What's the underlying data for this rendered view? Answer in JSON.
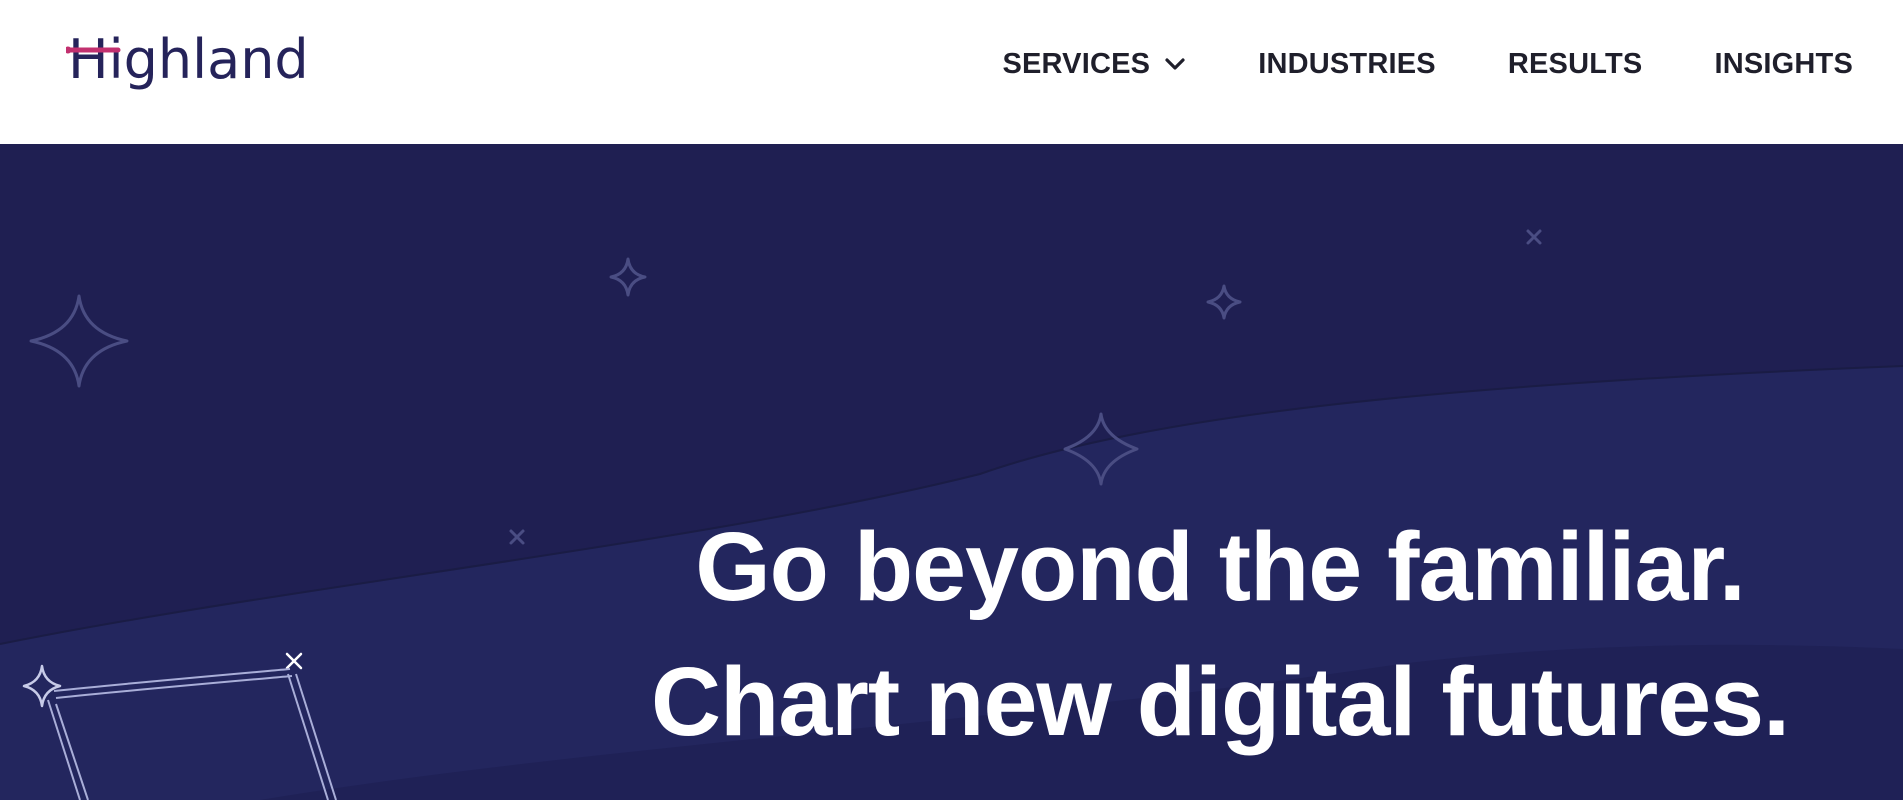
{
  "brand": {
    "name": "Highland",
    "logo_text": "Highland",
    "text_color": "#25235a",
    "accent_color": "#c2306f"
  },
  "nav": {
    "items": [
      {
        "label": "SERVICES",
        "has_dropdown": true,
        "icon": "chevron-down-icon"
      },
      {
        "label": "INDUSTRIES",
        "has_dropdown": false
      },
      {
        "label": "RESULTS",
        "has_dropdown": false
      },
      {
        "label": "INSIGHTS",
        "has_dropdown": false
      }
    ],
    "text_color": "#1f1f2b"
  },
  "hero": {
    "headline_line1": "Go beyond the familiar.",
    "headline_line2": "Chart new digital futures.",
    "background_color": "#1f1f52",
    "wave_color": "#23265e",
    "decorations": [
      "sparkle-icon",
      "x-mark-icon",
      "constellation-illustration"
    ]
  }
}
